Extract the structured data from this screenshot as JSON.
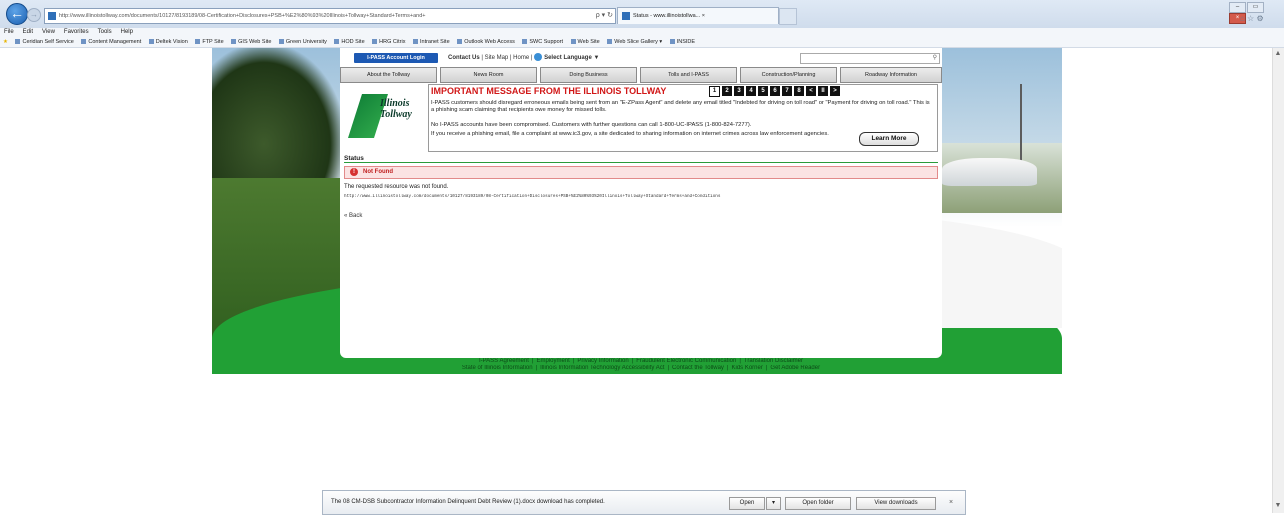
{
  "browser": {
    "address": "http://www.illinoistollway.com/documents/10127/8193189/08-Certification+Disclosures+PSB+%E2%80%93%20Illinois+Tollway+Standard+Terms+and+",
    "address_controls": "ρ ▾ ↻",
    "tab_title": "Status - www.illinoistollwa... ×",
    "back_glyph": "←",
    "fwd_glyph": "→",
    "window_controls": [
      "–",
      "▭",
      "×"
    ],
    "tools_icons": "⌂ ☆ ⚙"
  },
  "menu": [
    "File",
    "Edit",
    "View",
    "Favorites",
    "Tools",
    "Help"
  ],
  "favorites": [
    "Ceridian Self Service",
    "Content Management",
    "Deltek Vision",
    "FTP Site",
    "GIS Web Site",
    "Green University",
    "HOD Site",
    "HRG Citrix",
    "Intranet Site",
    "Outlook Web Access",
    "SWC Support",
    "Web Site",
    "Web Slice Gallery ▾",
    "INSIDE"
  ],
  "site": {
    "ipass_login": "I-PASS Account Login",
    "contact_us": "Contact Us",
    "site_map": "Site Map",
    "home": "Home",
    "select_language": "Select Language",
    "lang_arrow": "▼",
    "search_glyph": "⚲",
    "nav": [
      "About the Tollway",
      "News Room",
      "Doing Business",
      "Tolls and I-PASS",
      "Construction/Planning",
      "Roadway Information"
    ],
    "logo_line1": "Illinois",
    "logo_line2": "Tollway",
    "msg_title": "IMPORTANT MESSAGE FROM THE ILLINOIS TOLLWAY",
    "pager": [
      "1",
      "2",
      "3",
      "4",
      "5",
      "6",
      "7",
      "8",
      "<",
      "II",
      ">"
    ],
    "msg_p1": "I-PASS customers should disregard erroneous emails being sent from an \"E-ZPass Agent\" and delete any email titled \"Indebted for driving on toll road\" or \"Payment for driving on toll road.\" This is a phishing scam claiming that recipients owe money for missed tolls.",
    "msg_p2": "No I-PASS accounts have been compromised. Customers with further questions can call 1-800-UC-IPASS (1-800-824-7277).",
    "msg_p3": "If you receive a phishing email, file a complaint at www.ic3.gov, a site dedicated to sharing information on internet crimes across law enforcement agencies.",
    "learn_more": "Learn More",
    "status_heading": "Status",
    "error_icon": "!",
    "error_title": "Not Found",
    "resource_msg": "The requested resource was not found.",
    "request_url": "http://www.illinoistollway.com/documents/10127/8193189/08-Certification+Disclosures+PSB+%E2%80%93%20Illinois+Tollway+Standard+Terms+and+Conditions",
    "back": "« Back",
    "footer_row1": [
      "I-PASS Agreement",
      "Employment",
      "Privacy Information",
      "Fraudulent Electronic Communication",
      "Translation Disclaimer"
    ],
    "footer_row2": [
      "State of Illinois Information",
      "Illinois Information Technology Accessibility Act",
      "Contact the Tollway",
      "Kids Korner",
      "Get Adobe Reader"
    ]
  },
  "download": {
    "message": "The 08 CM-DSB Subcontractor Information Delinquent Debt Review (1).docx download has completed.",
    "open": "Open",
    "open_arrow": "▾",
    "open_folder": "Open folder",
    "view_downloads": "View downloads",
    "close": "×"
  },
  "scroll": {
    "up": "▲",
    "down": "▼"
  },
  "colors": {
    "accent_green": "#21a035",
    "ipass_blue": "#1d59b3",
    "alert_red": "#d11717"
  }
}
